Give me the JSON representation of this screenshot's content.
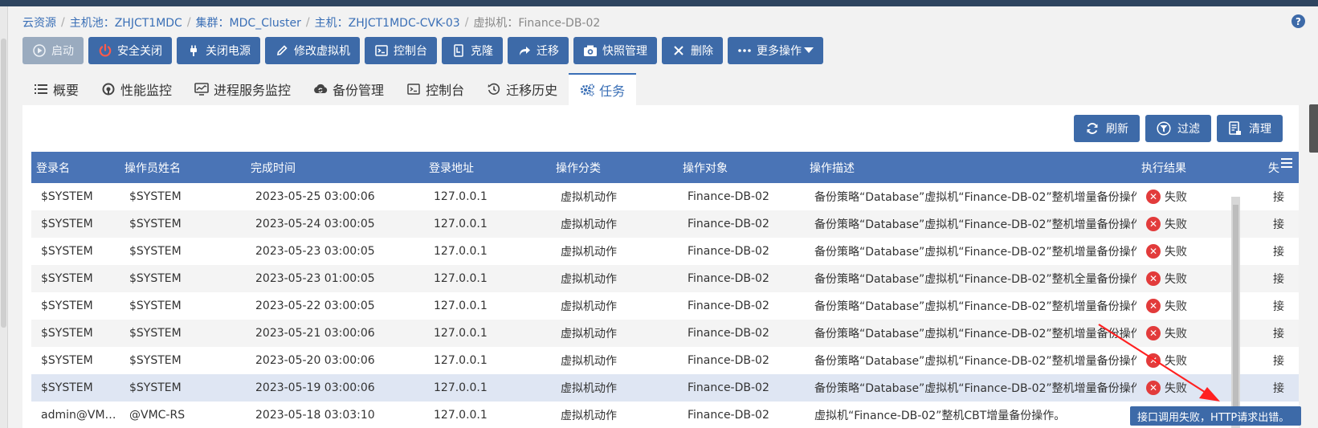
{
  "breadcrumb": [
    {
      "label": "云资源"
    },
    {
      "label": "主机池：ZHJCT1MDC"
    },
    {
      "label": "集群：MDC_Cluster"
    },
    {
      "label": "主机：ZHJCT1MDC-CVK-03"
    },
    {
      "label": "虚拟机：Finance-DB-02"
    }
  ],
  "help": "?",
  "toolbar": {
    "start": "启动",
    "safe_shutdown": "安全关闭",
    "power_off": "关闭电源",
    "edit_vm": "修改虚拟机",
    "console": "控制台",
    "clone": "克隆",
    "migrate": "迁移",
    "snapshot": "快照管理",
    "delete": "删除",
    "more": "更多操作"
  },
  "tabs": {
    "overview": "概要",
    "perf": "性能监控",
    "process": "进程服务监控",
    "backup": "备份管理",
    "console": "控制台",
    "migration": "迁移历史",
    "task": "任务"
  },
  "actions": {
    "refresh": "刷新",
    "filter": "过滤",
    "clear": "清理"
  },
  "table": {
    "headers": [
      "登录名",
      "操作员姓名",
      "完成时间",
      "登录地址",
      "操作分类",
      "操作对象",
      "操作描述",
      "执行结果",
      "失"
    ],
    "rows": [
      [
        "$SYSTEM",
        "$SYSTEM",
        "2023-05-25 03:00:06",
        "127.0.0.1",
        "虚拟机动作",
        "Finance-DB-02",
        "备份策略“Database”虚拟机“Finance-DB-02”整机增量备份操作。",
        "失败",
        "接"
      ],
      [
        "$SYSTEM",
        "$SYSTEM",
        "2023-05-24 03:00:05",
        "127.0.0.1",
        "虚拟机动作",
        "Finance-DB-02",
        "备份策略“Database”虚拟机“Finance-DB-02”整机增量备份操作。",
        "失败",
        "接"
      ],
      [
        "$SYSTEM",
        "$SYSTEM",
        "2023-05-23 03:00:05",
        "127.0.0.1",
        "虚拟机动作",
        "Finance-DB-02",
        "备份策略“Database”虚拟机“Finance-DB-02”整机增量备份操作。",
        "失败",
        "接"
      ],
      [
        "$SYSTEM",
        "$SYSTEM",
        "2023-05-23 01:00:05",
        "127.0.0.1",
        "虚拟机动作",
        "Finance-DB-02",
        "备份策略“Database”虚拟机“Finance-DB-02”整机全量备份操作。",
        "失败",
        "接"
      ],
      [
        "$SYSTEM",
        "$SYSTEM",
        "2023-05-22 03:00:05",
        "127.0.0.1",
        "虚拟机动作",
        "Finance-DB-02",
        "备份策略“Database”虚拟机“Finance-DB-02”整机增量备份操作。",
        "失败",
        "接"
      ],
      [
        "$SYSTEM",
        "$SYSTEM",
        "2023-05-21 03:00:06",
        "127.0.0.1",
        "虚拟机动作",
        "Finance-DB-02",
        "备份策略“Database”虚拟机“Finance-DB-02”整机增量备份操作。",
        "失败",
        "接"
      ],
      [
        "$SYSTEM",
        "$SYSTEM",
        "2023-05-20 03:00:06",
        "127.0.0.1",
        "虚拟机动作",
        "Finance-DB-02",
        "备份策略“Database”虚拟机“Finance-DB-02”整机增量备份操作。",
        "失败",
        "接"
      ],
      [
        "$SYSTEM",
        "$SYSTEM",
        "2023-05-19 03:00:06",
        "127.0.0.1",
        "虚拟机动作",
        "Finance-DB-02",
        "备份策略“Database”虚拟机“Finance-DB-02”整机增量备份操作。",
        "失败",
        "接"
      ],
      [
        "admin@VM…",
        "@VMC-RS",
        "2023-05-18 03:03:10",
        "127.0.0.1",
        "虚拟机动作",
        "Finance-DB-02",
        "虚拟机“Finance-DB-02”整机CBT增量备份操作。",
        "",
        ""
      ]
    ]
  },
  "tooltip": "接口调用失败，HTTP请求出错。",
  "colors": {
    "primary": "#3d6aa8",
    "header": "#4a74b6",
    "fail": "#e23b3b",
    "annotation": "#ff2020"
  }
}
